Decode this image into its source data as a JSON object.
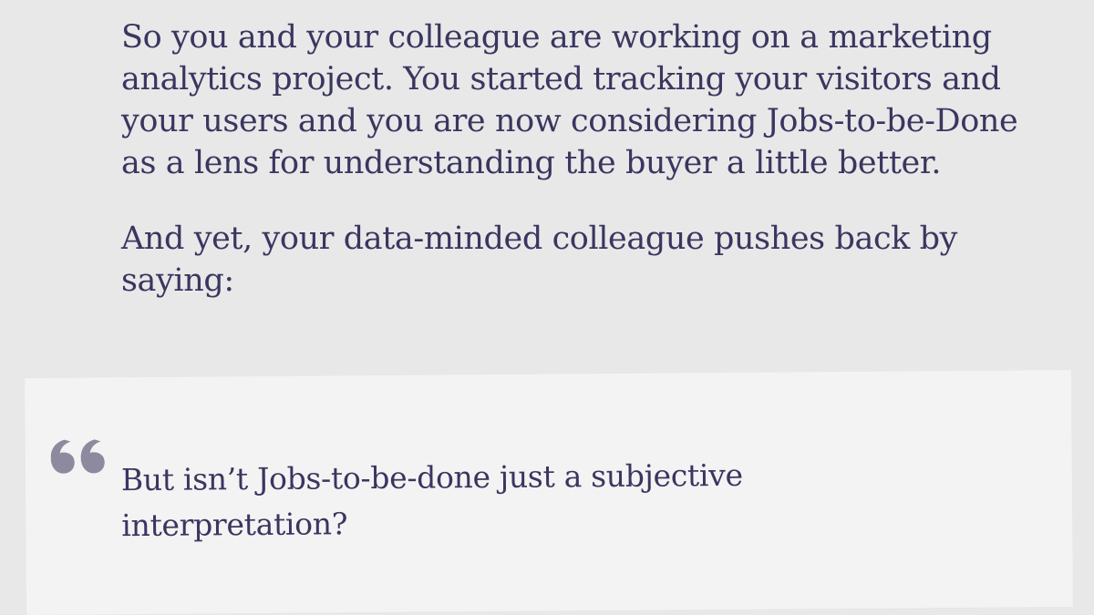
{
  "article": {
    "paragraphs": [
      "So you and your colleague are working on a marketing analytics project. You started tracking your visitors and your users and you are now considering Jobs-to-be-Done as a lens for understanding the buyer a little better.",
      "And yet, your data-minded colleague pushes back by saying:"
    ]
  },
  "quote": {
    "icon": "quote-open-icon",
    "text": "But isn’t Jobs-to-be-done just a subjective interpretation?"
  },
  "colors": {
    "background": "#e8e8e8",
    "card": "#f3f3f3",
    "text": "#3a3660",
    "quote_mark": "#8d8a9f"
  }
}
